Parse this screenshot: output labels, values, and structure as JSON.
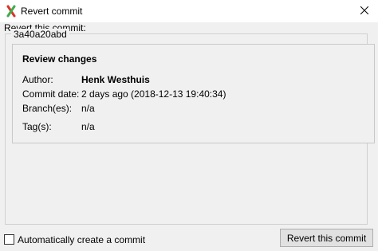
{
  "window": {
    "title": "Revert commit",
    "icon": "git-extensions-icon",
    "close_icon": "close-icon"
  },
  "revert_label": "Revert this commit:",
  "commit_hash": "3a40a20abd",
  "review": {
    "heading": "Review changes",
    "rows": [
      {
        "label": "Author:",
        "value": "Henk Westhuis"
      },
      {
        "label": "Commit date:",
        "value": "2 days ago (2018-12-13 19:40:34)"
      },
      {
        "label": "Branch(es):",
        "value": "n/a"
      },
      {
        "label": "Tag(s):",
        "value": "n/a"
      }
    ]
  },
  "footer": {
    "auto_commit_label": "Automatically create a commit",
    "auto_commit_checked": false,
    "revert_button": "Revert this commit"
  }
}
